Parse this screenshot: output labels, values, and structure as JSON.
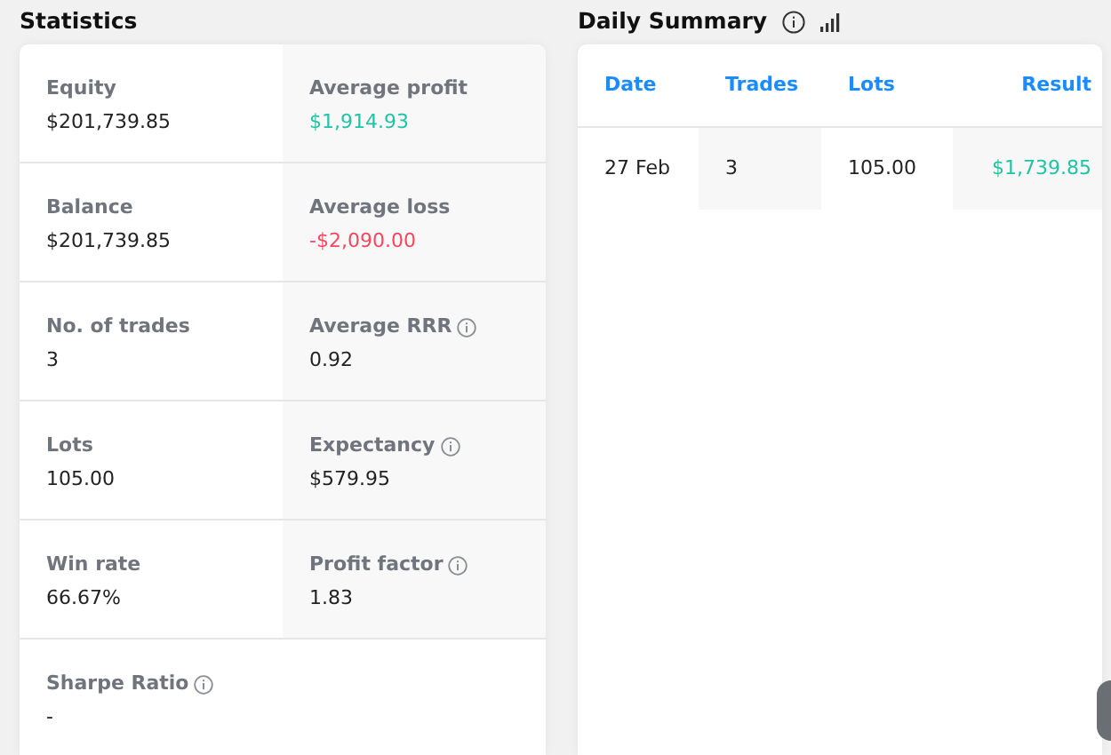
{
  "statistics": {
    "title": "Statistics",
    "items": [
      {
        "label": "Equity",
        "value": "$201,739.85",
        "info": false
      },
      {
        "label": "Average profit",
        "value": "$1,914.93",
        "color": "#1fc4a4",
        "info": false
      },
      {
        "label": "Balance",
        "value": "$201,739.85",
        "info": false
      },
      {
        "label": "Average loss",
        "value": "-$2,090.00",
        "color": "#f5475d",
        "info": false
      },
      {
        "label": "No. of trades",
        "value": "3",
        "info": false
      },
      {
        "label": "Average RRR",
        "value": "0.92",
        "info": true
      },
      {
        "label": "Lots",
        "value": "105.00",
        "info": false
      },
      {
        "label": "Expectancy",
        "value": "$579.95",
        "info": true
      },
      {
        "label": "Win rate",
        "value": "66.67%",
        "info": false
      },
      {
        "label": "Profit factor",
        "value": "1.83",
        "info": true
      },
      {
        "label": "Sharpe Ratio",
        "value": "-",
        "info": true
      }
    ]
  },
  "daily_summary": {
    "title": "Daily Summary",
    "table": {
      "columns": [
        "Date",
        "Trades",
        "Lots",
        "Result"
      ],
      "rows": [
        {
          "cells": [
            "27 Feb",
            "3",
            "105.00",
            "$1,739.85"
          ],
          "color": "#1fc4a4"
        }
      ]
    }
  }
}
